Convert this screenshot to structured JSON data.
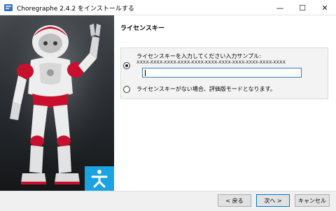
{
  "window": {
    "title": "Choregraphe 2.4.2 をインストールする",
    "minimize_icon": "—",
    "maximize_icon": "☐",
    "close_icon": "✕"
  },
  "header": {
    "title": "ライセンスキー"
  },
  "options": {
    "license_key": {
      "label": "ライセンスキーを入力してください入力サンプル:",
      "sample": "XXXX-XXXX-XXXX-XXXX-XXXX-XXXX-XXXX-XXXX-XXXX-XXXX-XXXX",
      "input_value": "",
      "selected": true
    },
    "no_license": {
      "label": "ライセンスキーがない場合、評価版モードとなります。",
      "selected": false
    }
  },
  "footer": {
    "back_label": "< 戻る",
    "next_label": "次へ >",
    "cancel_label": "キャンセル"
  },
  "colors": {
    "accent": "#1aa3e0",
    "robot_red": "#c8102e",
    "input_border": "#3c7fb1"
  }
}
